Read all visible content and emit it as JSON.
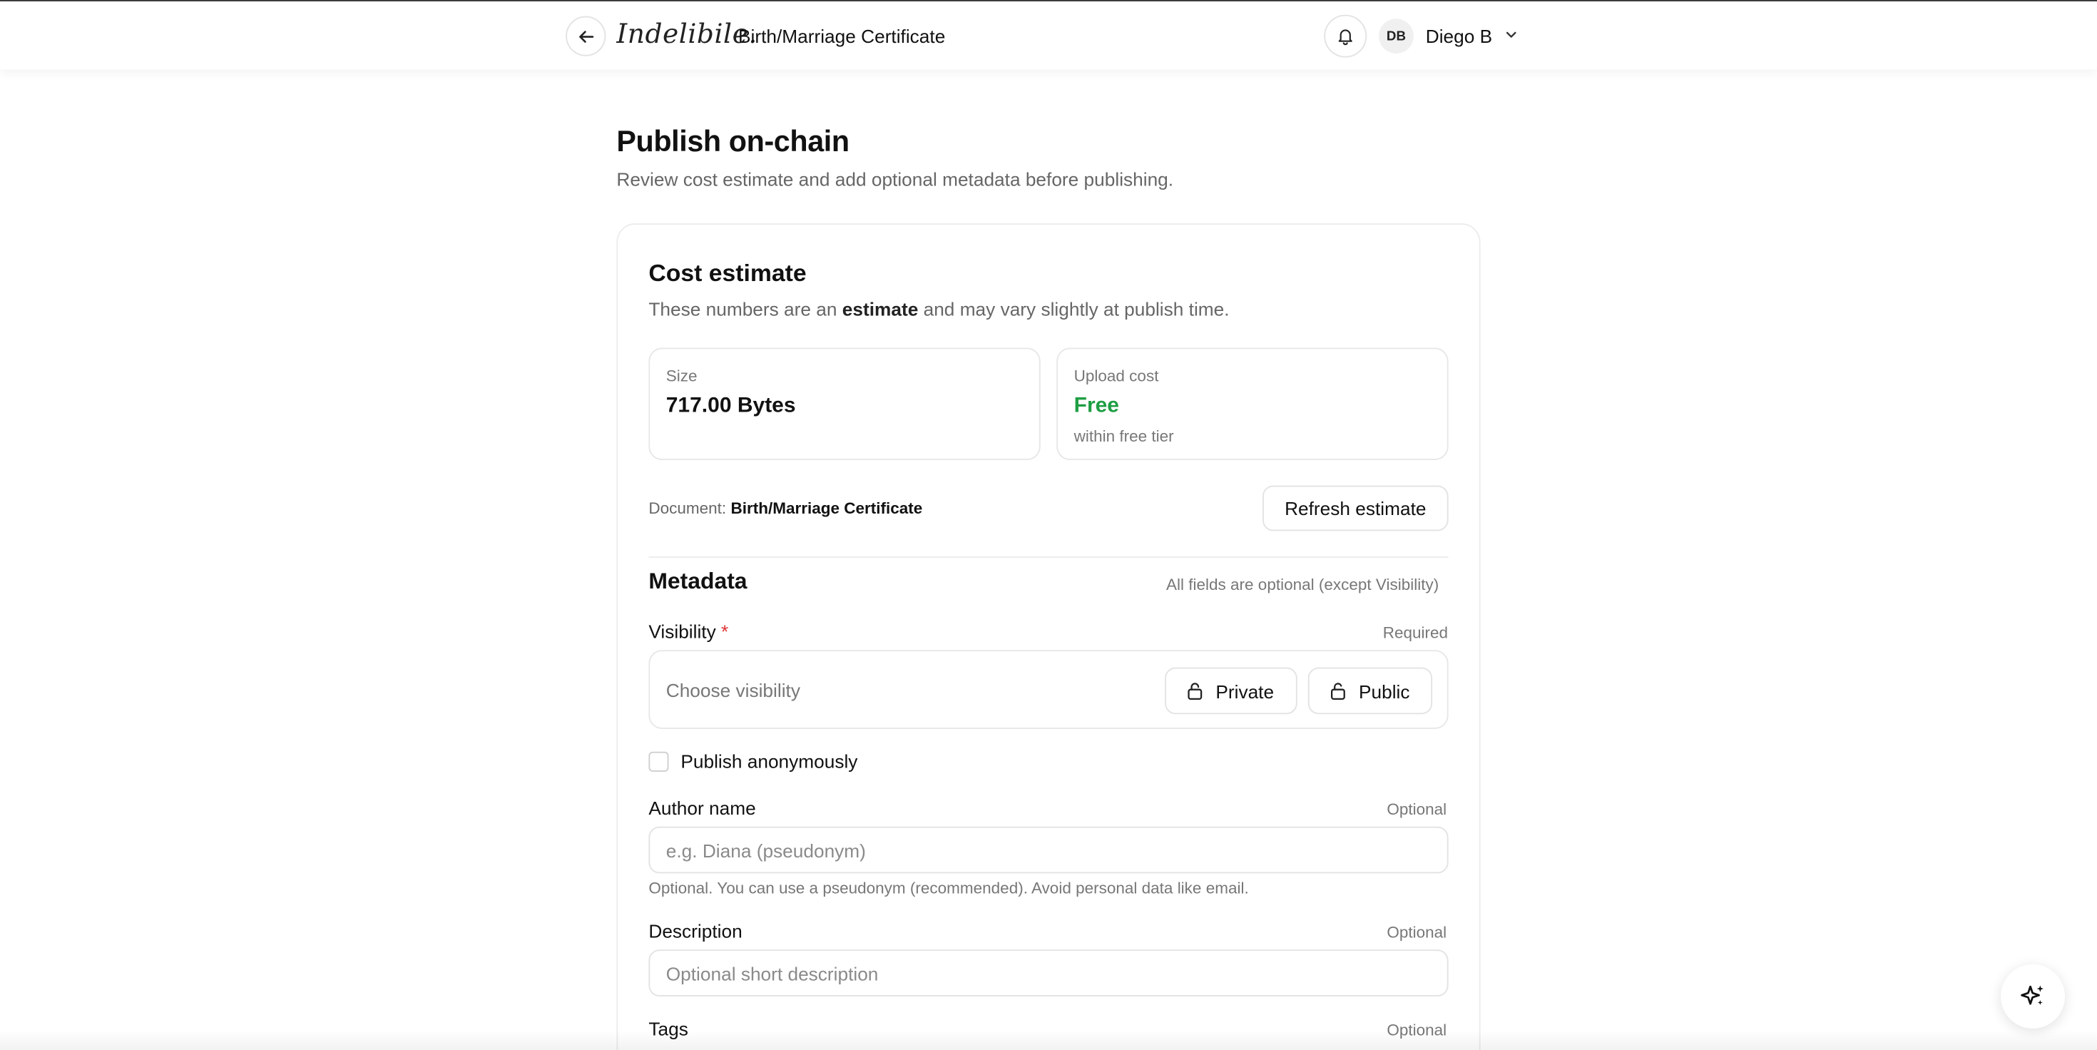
{
  "header": {
    "logo": "Indelibile.",
    "document_title": "Birth/Marriage Certificate",
    "user": {
      "initials": "DB",
      "name": "Diego B"
    }
  },
  "page": {
    "title": "Publish on-chain",
    "subtitle": "Review cost estimate and add optional metadata before publishing."
  },
  "cost_estimate": {
    "title": "Cost estimate",
    "subtitle_pre": "These numbers are an ",
    "subtitle_bold": "estimate",
    "subtitle_post": " and may vary slightly at publish time.",
    "size_label": "Size",
    "size_value": "717.00 Bytes",
    "upload_label": "Upload cost",
    "upload_value": "Free",
    "upload_note": "within free tier",
    "document_label": "Document:",
    "document_value": "Birth/Marriage Certificate",
    "refresh_label": "Refresh estimate"
  },
  "metadata": {
    "title": "Metadata",
    "note": "All fields are optional (except Visibility)",
    "visibility": {
      "label": "Visibility",
      "required_marker": "*",
      "right": "Required",
      "placeholder": "Choose visibility",
      "options": [
        "Private",
        "Public"
      ]
    },
    "anonymous_label": "Publish anonymously",
    "author": {
      "label": "Author name",
      "right": "Optional",
      "placeholder": "e.g. Diana (pseudonym)",
      "help": "Optional. You can use a pseudonym (recommended). Avoid personal data like email."
    },
    "description": {
      "label": "Description",
      "right": "Optional",
      "placeholder": "Optional short description"
    },
    "tags": {
      "label": "Tags",
      "right": "Optional"
    }
  },
  "colors": {
    "accent_green": "#1e9e43",
    "required_red": "#dd3333"
  }
}
